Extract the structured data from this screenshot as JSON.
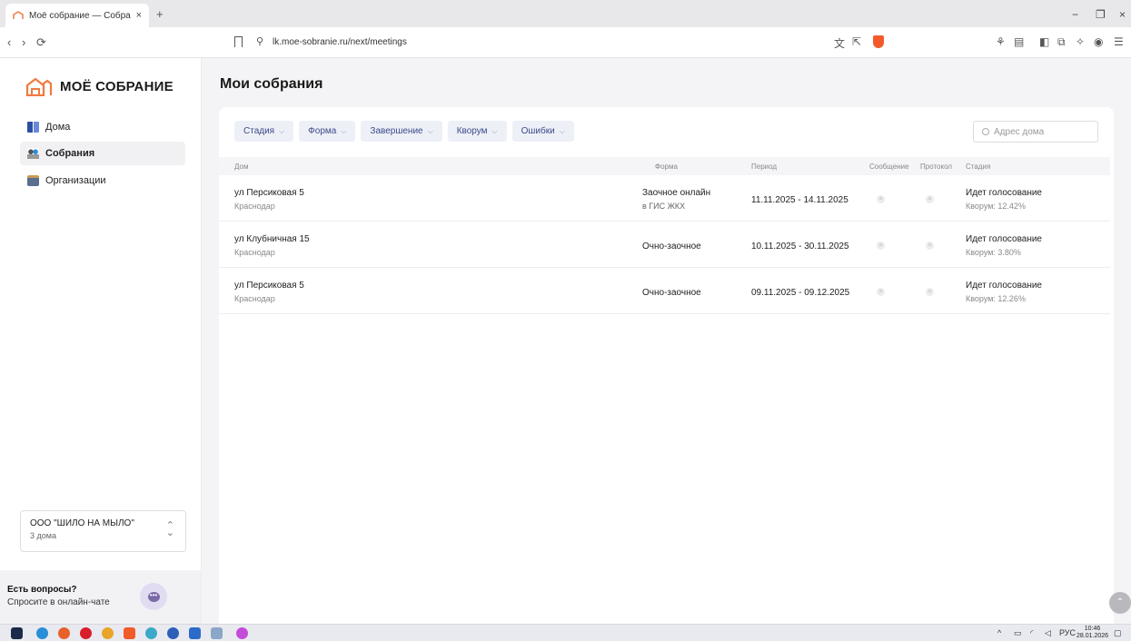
{
  "browser": {
    "tab_title": "Моё собрание — Собрания",
    "tab_close": "×",
    "new_tab": "+",
    "url": "lk.moe-sobranie.ru/next/meetings",
    "nav_back": "‹",
    "nav_forward": "›",
    "nav_reload": "⟳",
    "win_minimize": "−",
    "win_restore": "❐",
    "win_close": "×"
  },
  "sidebar": {
    "logo_text": "МОЁ СОБРАНИЕ",
    "items": [
      {
        "label": "Дома",
        "icon": "buildings-icon",
        "active": false
      },
      {
        "label": "Собрания",
        "icon": "people-icon",
        "active": true
      },
      {
        "label": "Организации",
        "icon": "briefcase-icon",
        "active": false
      }
    ],
    "org": {
      "name": "ООО \"ШИЛО НА МЫЛО\"",
      "sub": "3 дома",
      "arrow_up": "⌃",
      "arrow_down": "⌄"
    },
    "help": {
      "title": "Есть вопросы?",
      "sub": "Спросите в онлайн-чате",
      "chat_glyph": "•••"
    }
  },
  "main": {
    "title": "Мои собрания",
    "filters": [
      {
        "label": "Стадия"
      },
      {
        "label": "Форма"
      },
      {
        "label": "Завершение"
      },
      {
        "label": "Кворум"
      },
      {
        "label": "Ошибки"
      }
    ],
    "filter_chevron": "⌵",
    "search_placeholder": "Адрес дома",
    "columns": {
      "house": "Дом",
      "form": "Форма",
      "period": "Период",
      "message": "Сообщение",
      "protocol": "Протокол",
      "stage": "Стадия"
    },
    "dot_glyph": "×",
    "rows": [
      {
        "address": "ул Персиковая 5",
        "city": "Краснодар",
        "form": "Заочное онлайн",
        "form_sub": "в ГИС ЖКХ",
        "period": "11.11.2025 - 14.11.2025",
        "stage": "Идет голосование",
        "quorum": "Кворум: 12.42%"
      },
      {
        "address": "ул Клубничная 15",
        "city": "Краснодар",
        "form": "Очно-заочное",
        "form_sub": "",
        "period": "10.11.2025 - 30.11.2025",
        "stage": "Идет голосование",
        "quorum": "Кворум: 3.80%"
      },
      {
        "address": "ул Персиковая 5",
        "city": "Краснодар",
        "form": "Очно-заочное",
        "form_sub": "",
        "period": "09.11.2025 - 09.12.2025",
        "stage": "Идет голосование",
        "quorum": "Кворум: 12.26%"
      }
    ]
  },
  "scroll_top_glyph": "⌃",
  "taskbar": {
    "tray_chevron": "^",
    "lang": "РУС",
    "time": "10:46",
    "date": "28.01.2026"
  },
  "colors": {
    "brand": "#f07b3f",
    "filter_text": "#3b4a8a",
    "sidebar_active": "#f1f1f4"
  }
}
